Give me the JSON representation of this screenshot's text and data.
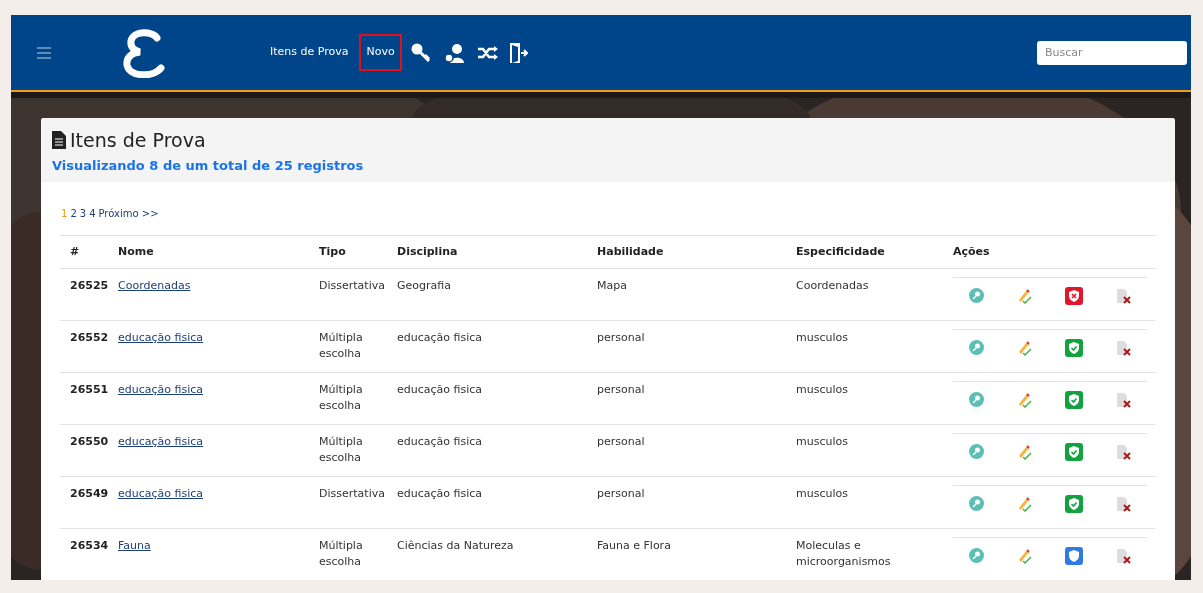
{
  "nav": {
    "links": [
      {
        "label": "Itens de Prova",
        "selected": false
      },
      {
        "label": "Novo",
        "selected": true
      }
    ],
    "search": {
      "placeholder": "Buscar"
    }
  },
  "panel": {
    "title": "Itens de Prova",
    "subtitle": "Visualizando 8 de um total de 25 registros"
  },
  "pagination": {
    "pages": [
      {
        "label": "1",
        "selected": true
      },
      {
        "label": "2",
        "selected": false
      },
      {
        "label": "3",
        "selected": false
      },
      {
        "label": "4",
        "selected": false
      }
    ],
    "next": "Próximo >>"
  },
  "table": {
    "columns": [
      "#",
      "Nome",
      "Tipo",
      "Disciplina",
      "Habilidade",
      "Especificidade",
      "Ações"
    ],
    "rows": [
      {
        "id": "26525",
        "name": "Coordenadas",
        "type": "Dissertativa",
        "subject": "Geografia",
        "skill": "Mapa",
        "specificity": "Coordenadas",
        "kind": "rejected"
      },
      {
        "id": "26552",
        "name": "educação fisica",
        "type": "Múltipla escolha",
        "subject": "educação fisica",
        "skill": "personal",
        "specificity": "musculos",
        "kind": "approved"
      },
      {
        "id": "26551",
        "name": "educação fisica",
        "type": "Múltipla escolha",
        "subject": "educação fisica",
        "skill": "personal",
        "specificity": "musculos",
        "kind": "approved"
      },
      {
        "id": "26550",
        "name": "educação fisica",
        "type": "Múltipla escolha",
        "subject": "educação fisica",
        "skill": "personal",
        "specificity": "musculos",
        "kind": "approved"
      },
      {
        "id": "26549",
        "name": "educação fisica",
        "type": "Dissertativa",
        "subject": "educação fisica",
        "skill": "personal",
        "specificity": "musculos",
        "kind": "approved"
      },
      {
        "id": "26534",
        "name": "Fauna",
        "type": "Múltipla escolha",
        "subject": "Ciências da Natureza",
        "skill": "Fauna e Flora",
        "specificity": "Moleculas e microorganismos",
        "kind": "pending"
      }
    ]
  }
}
